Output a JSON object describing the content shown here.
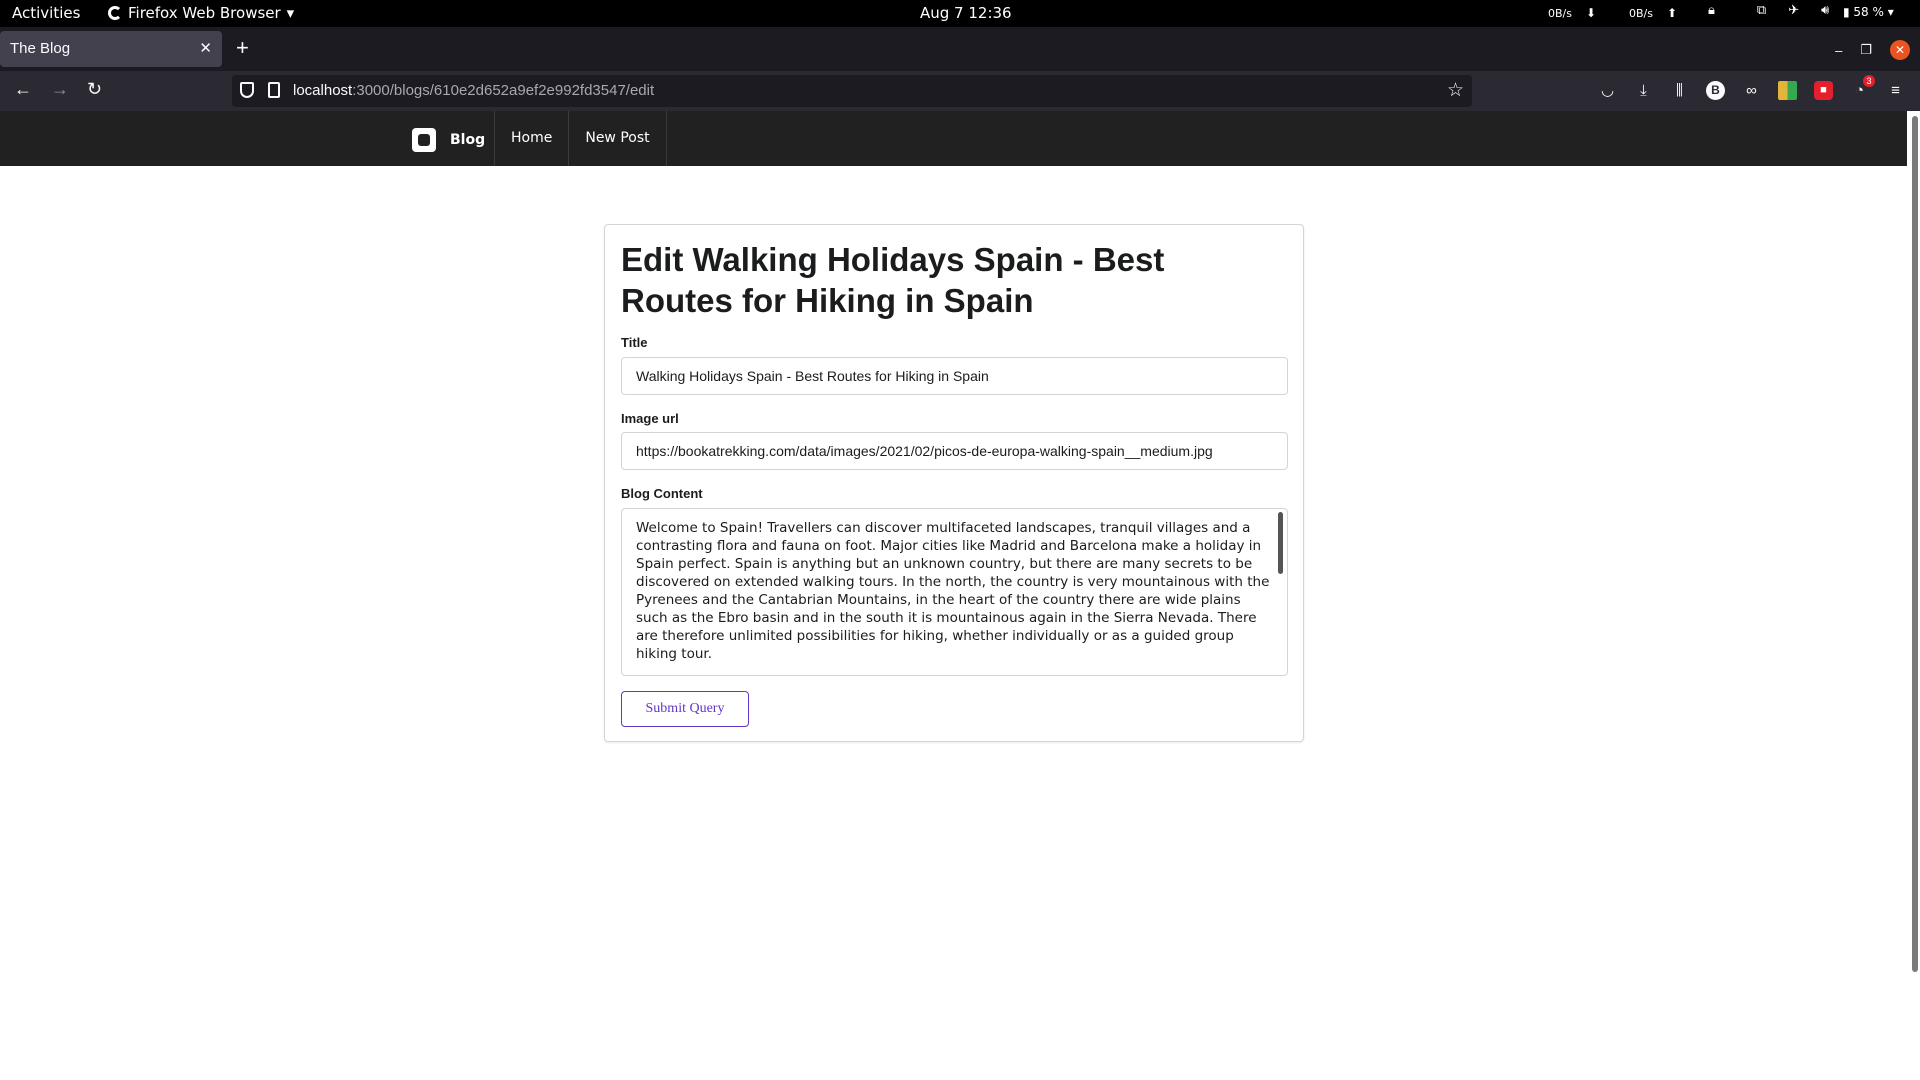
{
  "os_bar": {
    "activities": "Activities",
    "app_name": "Firefox Web Browser",
    "clock": "Aug 7  12:36",
    "net_down": "0B/s",
    "net_up": "0B/s",
    "battery": "58 %"
  },
  "browser": {
    "tab_title": "The Blog",
    "url_host": "localhost",
    "url_path": ":3000/blogs/610e2d652a9ef2e992fd3547/edit",
    "extension_badge": "3"
  },
  "site_nav": {
    "brand": "Blog",
    "links": [
      "Home",
      "New Post"
    ]
  },
  "form": {
    "heading": "Edit Walking Holidays Spain - Best Routes for Hiking in Spain",
    "title_label": "Title",
    "title_value": "Walking Holidays Spain - Best Routes for Hiking in Spain",
    "image_label": "Image url",
    "image_value": "https://bookatrekking.com/data/images/2021/02/picos-de-europa-walking-spain__medium.jpg",
    "content_label": "Blog Content",
    "content_value": "Welcome to Spain! Travellers can discover multifaceted landscapes, tranquil villages and a contrasting flora and fauna on foot. Major cities like Madrid and Barcelona make a holiday in Spain perfect. Spain is anything but an unknown country, but there are many secrets to be discovered on extended walking tours. In the north, the country is very mountainous with the Pyrenees and the Cantabrian Mountains, in the heart of the country there are wide plains such as the Ebro basin and in the south it is mountainous again in the Sierra Nevada. There are therefore unlimited possibilities for hiking, whether individually or as a guided group hiking tour.",
    "submit_label": "Submit Query"
  },
  "colors": {
    "accent": "#6435c9",
    "site_nav_bg": "#212121",
    "browser_toolbar": "#2b2a33"
  }
}
